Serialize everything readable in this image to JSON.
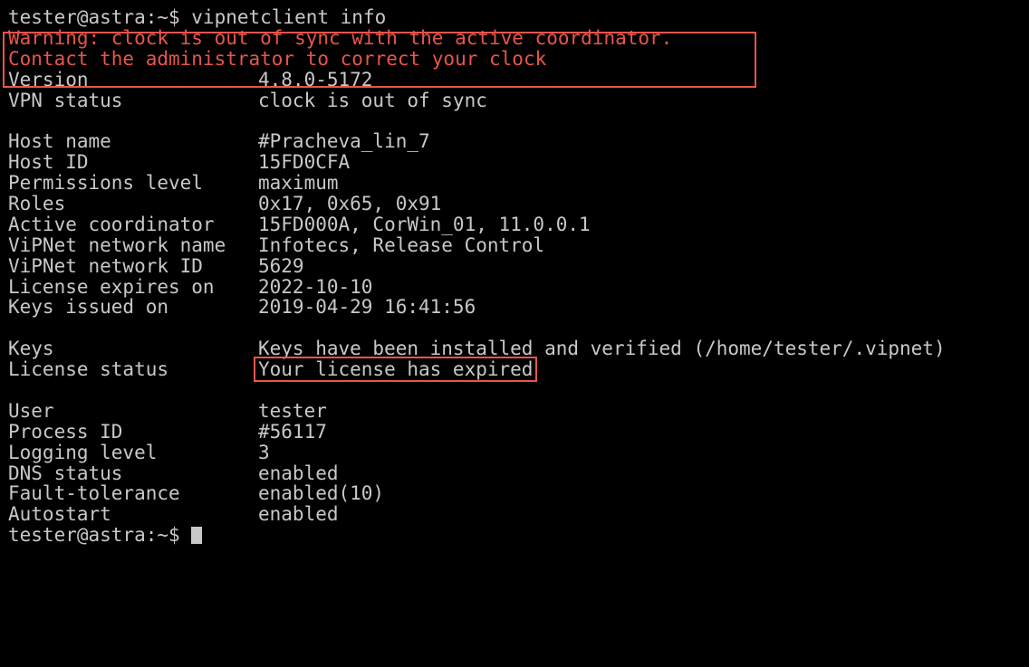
{
  "prompt": {
    "first": "tester@astra:~$ vipnetclient info",
    "last": "tester@astra:~$ "
  },
  "warning": {
    "line1": "Warning: clock is out of sync with the active coordinator.",
    "line2": "Contact the administrator to correct your clock"
  },
  "rows": {
    "version": {
      "key": "Version",
      "value": "4.8.0-5172"
    },
    "vpn_status": {
      "key": "VPN status",
      "value": "clock is out of sync"
    },
    "host_name": {
      "key": "Host name",
      "value": "#Pracheva_lin_7"
    },
    "host_id": {
      "key": "Host ID",
      "value": "15FD0CFA"
    },
    "permissions": {
      "key": "Permissions level",
      "value": "maximum"
    },
    "roles": {
      "key": "Roles",
      "value": "0x17, 0x65, 0x91"
    },
    "active_coord": {
      "key": "Active coordinator",
      "value": "15FD000A, CorWin_01, 11.0.0.1"
    },
    "net_name": {
      "key": "ViPNet network name",
      "value": "Infotecs, Release Control"
    },
    "net_id": {
      "key": "ViPNet network ID",
      "value": "5629"
    },
    "license_expires": {
      "key": "License expires on",
      "value": "2022-10-10"
    },
    "keys_issued": {
      "key": "Keys issued on",
      "value": "2019-04-29 16:41:56"
    },
    "keys": {
      "key": "Keys",
      "value_underlined": "Keys have been installed",
      "value_rest": " and verified (/home/tester/.vipnet)"
    },
    "license_status": {
      "key": "License status",
      "value": "Your license has expired"
    },
    "user": {
      "key": "User",
      "value": "tester"
    },
    "process_id": {
      "key": "Process ID",
      "value": "#56117"
    },
    "logging_level": {
      "key": "Logging level",
      "value": "3"
    },
    "dns_status": {
      "key": "DNS status",
      "value": "enabled"
    },
    "fault_tolerance": {
      "key": "Fault-tolerance",
      "value": "enabled(10)"
    },
    "autostart": {
      "key": "Autostart",
      "value": "enabled"
    }
  },
  "colors": {
    "background": "#000000",
    "text": "#c8c8c8",
    "warning": "#e8554a"
  }
}
